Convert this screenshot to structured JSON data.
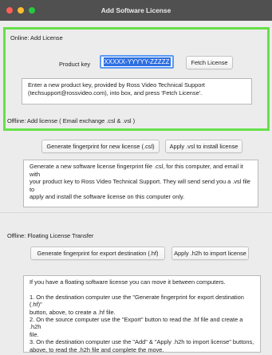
{
  "window": {
    "title": "Add Software License"
  },
  "online": {
    "label": "Online: Add License",
    "product_key_label": "Product key",
    "product_key_value": "XXXXX-YYYYY-ZZZZZ",
    "fetch_button": "Fetch License",
    "help_text": "Enter a new product key, provided by Ross Video Technical Support\n(techsupport@rossvideo.com), into box, and press 'Fetch License'."
  },
  "offline": {
    "label": "Offline: Add license ( Email exchange .csl & .vsl )",
    "fingerprint_button": "Generate fingerprint for new license (.csl)",
    "apply_button": "Apply .vsl to install license",
    "help_text": "Generate a new software license fingerprint file .csl, for this computer, and email it with\nyour product key to Ross Video Technical Support. They will send send you a .vsl file to\napply and install the software license on this computer only."
  },
  "floating": {
    "label": "Offline: Floating License Transfer",
    "export_button": "Generate fingerprint for export destination (.hf)",
    "import_button": "Apply .h2h to import license",
    "help_text": "If you have a floating software license you can move it between computers.\n\n1. On the destination computer use the \"Generate fingerprint for export destination (.hf)\"\nbutton, above, to create a .hf file.\n2. On the source computer use the \"Export\" button to read the .hf file and create a .h2h\nfile.\n3. On the destination computer use the \"Add\" & \"Apply .h2h to import license\" buttons,\nabove, to read the .h2h file and complete the move."
  },
  "colors": {
    "highlight_border": "#67e04a",
    "titlebar": "#505050",
    "selection": "#2f6fe0"
  }
}
